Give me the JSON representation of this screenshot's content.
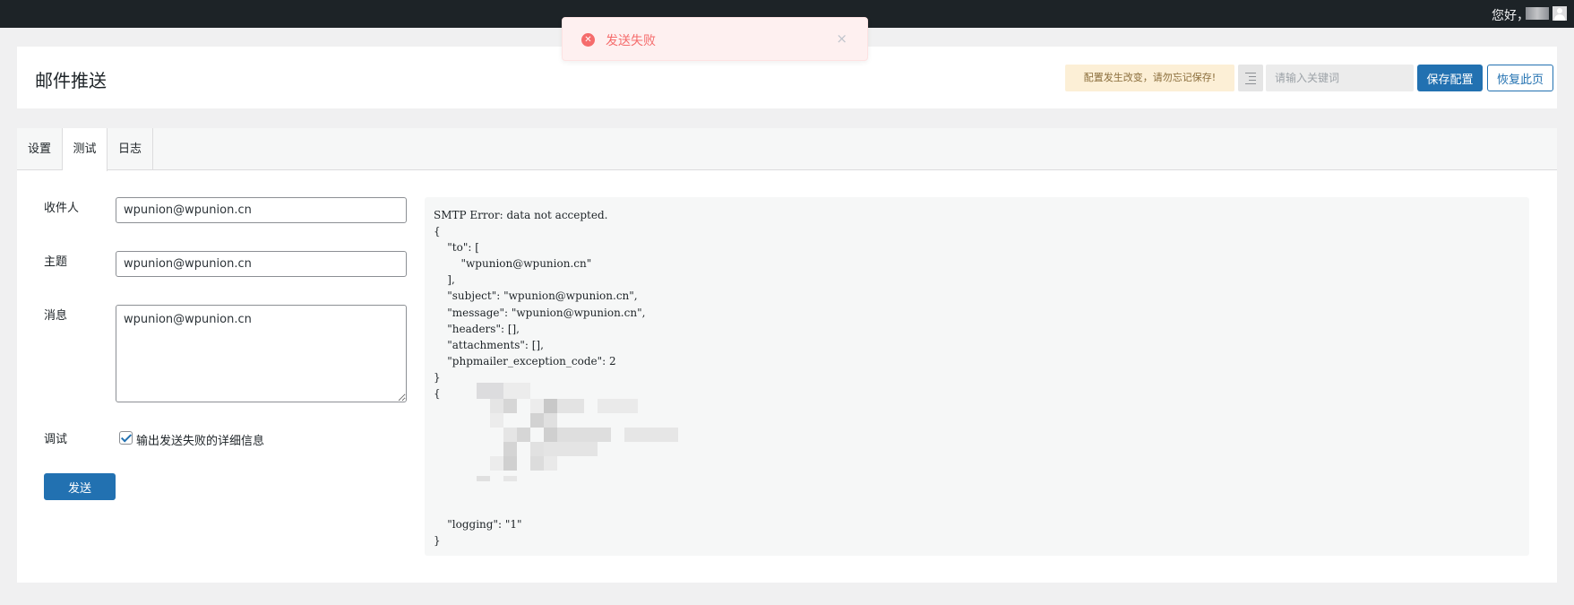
{
  "adminbar": {
    "greeting": "您好，"
  },
  "toast": {
    "icon": "error-icon",
    "message": "发送失败",
    "close_symbol": "×"
  },
  "header": {
    "title": "邮件推送",
    "notice": "配置发生改变，请勿忘记保存!",
    "search_placeholder": "请输入关键词",
    "save_label": "保存配置",
    "restore_label": "恢复此页"
  },
  "tabs": [
    {
      "label": "设置",
      "active": false
    },
    {
      "label": "测试",
      "active": true
    },
    {
      "label": "日志",
      "active": false
    }
  ],
  "form": {
    "recipient": {
      "label": "收件人",
      "value": "wpunion@wpunion.cn"
    },
    "subject": {
      "label": "主题",
      "value": "wpunion@wpunion.cn"
    },
    "message": {
      "label": "消息",
      "value": "wpunion@wpunion.cn"
    },
    "debug": {
      "label": "调试",
      "checkbox_label": "输出发送失败的详细信息",
      "checked": true
    },
    "send_label": "发送"
  },
  "output": {
    "lines": [
      "SMTP Error: data not accepted.",
      "{",
      "    \"to\": [",
      "        \"wpunion@wpunion.cn\"",
      "    ],",
      "    \"subject\": \"wpunion@wpunion.cn\",",
      "    \"message\": \"wpunion@wpunion.cn\",",
      "    \"headers\": [],",
      "    \"attachments\": [],",
      "    \"phpmailer_exception_code\": 2",
      "}",
      "{"
    ],
    "tail_lines": [
      "    \"logging\": \"1\"",
      "}"
    ]
  }
}
